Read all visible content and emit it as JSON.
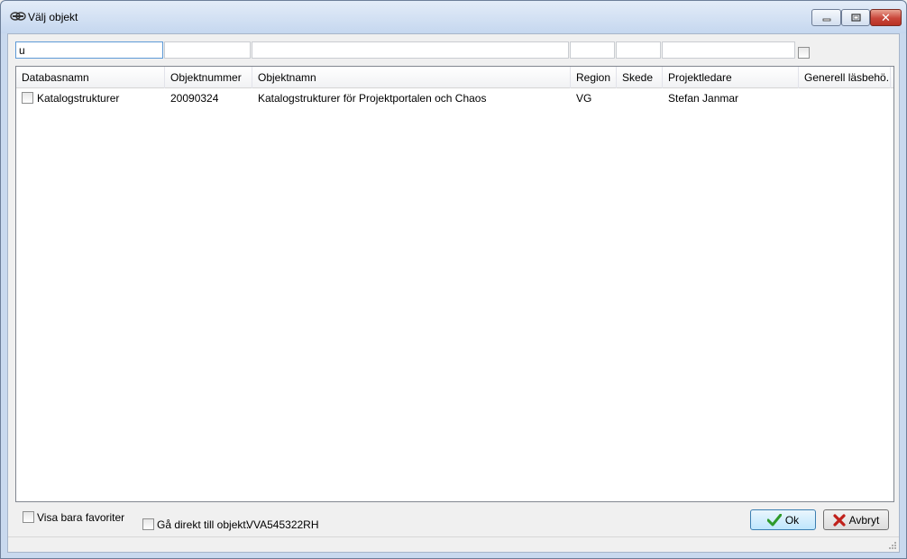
{
  "window": {
    "title": "Välj objekt",
    "icon": "app-logo-icon"
  },
  "filters": {
    "databasnamn": "u",
    "objektnummer": "",
    "objektnamn": "",
    "region": "",
    "skede": "",
    "projektledare": ""
  },
  "grid": {
    "columns": [
      "Databasnamn",
      "Objektnummer",
      "Objektnamn",
      "Region",
      "Skede",
      "Projektledare",
      "Generell läsbehö..."
    ],
    "rows": [
      {
        "databasnamn": "Katalogstrukturer",
        "objektnummer": "20090324",
        "objektnamn": "Katalogstrukturer för Projektportalen och Chaos",
        "region": "VG",
        "skede": "",
        "projektledare": "Stefan Janmar",
        "generell": ""
      }
    ]
  },
  "bottom": {
    "favorites_label": "Visa bara favoriter",
    "direct_label": "Gå direkt till objekt:",
    "direct_value": "VVA545322RH"
  },
  "buttons": {
    "ok_label": "Ok",
    "cancel_label": "Avbryt"
  },
  "colors": {
    "ok_check": "#2e9a2a",
    "cancel_x": "#c0201a"
  }
}
